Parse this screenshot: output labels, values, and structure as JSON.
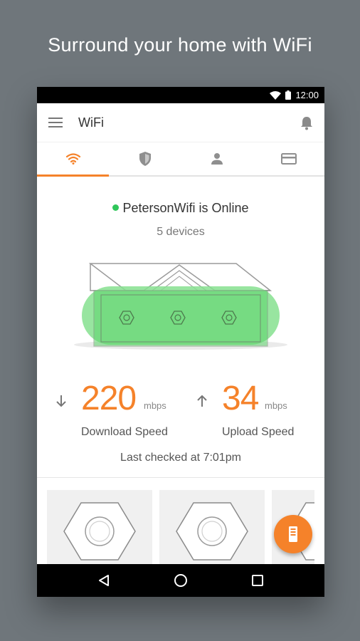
{
  "headline": "Surround your home with WiFi",
  "statusbar": {
    "time": "12:00"
  },
  "appbar": {
    "title": "WiFi",
    "menu_icon": "menu-icon",
    "bell_icon": "bell-icon"
  },
  "tabs": [
    {
      "icon": "wifi-icon",
      "active": true
    },
    {
      "icon": "shield-icon",
      "active": false
    },
    {
      "icon": "person-icon",
      "active": false
    },
    {
      "icon": "card-icon",
      "active": false
    }
  ],
  "network": {
    "status_text": "PetersonWifi is Online",
    "devices_text": "5 devices"
  },
  "download": {
    "value": "220",
    "unit": "mbps",
    "label": "Download Speed"
  },
  "upload": {
    "value": "34",
    "unit": "mbps",
    "label": "Upload Speed"
  },
  "last_checked": "Last checked at 7:01pm",
  "colors": {
    "accent": "#f5822a",
    "online": "#2fc65a",
    "house_fill": "#86e08f"
  }
}
